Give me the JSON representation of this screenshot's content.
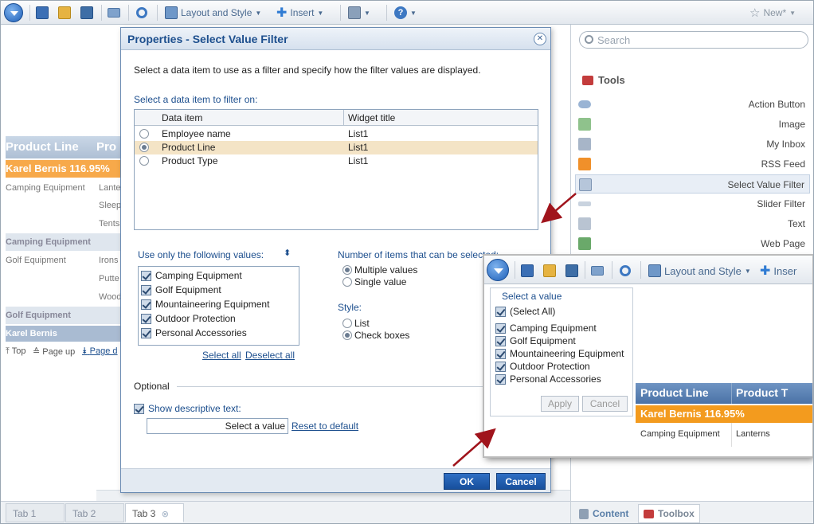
{
  "toolbar": {
    "layout_label": "Layout and Style",
    "insert_label": "Insert",
    "new_label": "New*"
  },
  "report": {
    "header_col1": "Product Line",
    "header_col2": "Pro",
    "orange_row": "Karel Bernis 116.95%",
    "row1_left": "Camping Equipment",
    "row1_right": [
      "Lante",
      "Sleep",
      "Tents"
    ],
    "band1": "Camping Equipment",
    "row2_left": "Golf Equipment",
    "row2_right": [
      "Irons",
      "Putte",
      "Wood"
    ],
    "band2": "Golf Equipment",
    "band3": "Karel Bernis",
    "nav_top": "Top",
    "nav_pageup": "Page up",
    "nav_pagedown": "Page d"
  },
  "page_tabs": [
    "Tab 1",
    "Tab 2",
    "Tab 3"
  ],
  "right_panel": {
    "search_placeholder": "Search",
    "tools_title": "Tools",
    "tools": [
      "Action Button",
      "Image",
      "My Inbox",
      "RSS Feed",
      "Select Value Filter",
      "Slider Filter",
      "Text",
      "Web Page"
    ],
    "selected_tool": "Select Value Filter",
    "tab_content": "Content",
    "tab_toolbox": "Toolbox"
  },
  "dialog": {
    "title": "Properties - Select Value Filter",
    "instructions": "Select a data item to use as a filter and specify how the filter values are displayed.",
    "select_item_label": "Select a data item to filter on:",
    "grid_headers": [
      "Data item",
      "Widget title"
    ],
    "grid_rows": [
      {
        "item": "Employee name",
        "title": "List1"
      },
      {
        "item": "Product Line",
        "title": "List1"
      },
      {
        "item": "Product Type",
        "title": "List1"
      }
    ],
    "selected_row": "Product Line",
    "use_values_label": "Use only the following values:",
    "values": [
      "Camping Equipment",
      "Golf Equipment",
      "Mountaineering Equipment",
      "Outdoor Protection",
      "Personal Accessories"
    ],
    "select_all": "Select all",
    "deselect_all": "Deselect all",
    "num_items_label": "Number of items that can be selected:",
    "multiple_values": "Multiple values",
    "single_value": "Single value",
    "style_label": "Style:",
    "style_list": "List",
    "style_checkboxes": "Check boxes",
    "optional_label": "Optional",
    "show_descriptive": "Show descriptive text:",
    "descriptive_value": "Select a value",
    "reset_default": "Reset to default",
    "ok": "OK",
    "cancel": "Cancel"
  },
  "inset": {
    "layout_label": "Layout and Style",
    "insert_label": "Inser",
    "filter_title": "Select a value",
    "select_all_item": "(Select All)",
    "values": [
      "Camping Equipment",
      "Golf Equipment",
      "Mountaineering Equipment",
      "Outdoor Protection",
      "Personal Accessories"
    ],
    "apply": "Apply",
    "cancel": "Cancel",
    "header_col1": "Product Line",
    "header_col2": "Product T",
    "orange_row": "Karel Bernis 116.95%",
    "cell_left": "Camping Equipment",
    "cell_right": "Lanterns"
  },
  "colors": {
    "accent_blue": "#1d4f8e",
    "orange": "#f39b1e",
    "selected_row": "#f4e4c6",
    "arrow_red": "#a0141c"
  }
}
